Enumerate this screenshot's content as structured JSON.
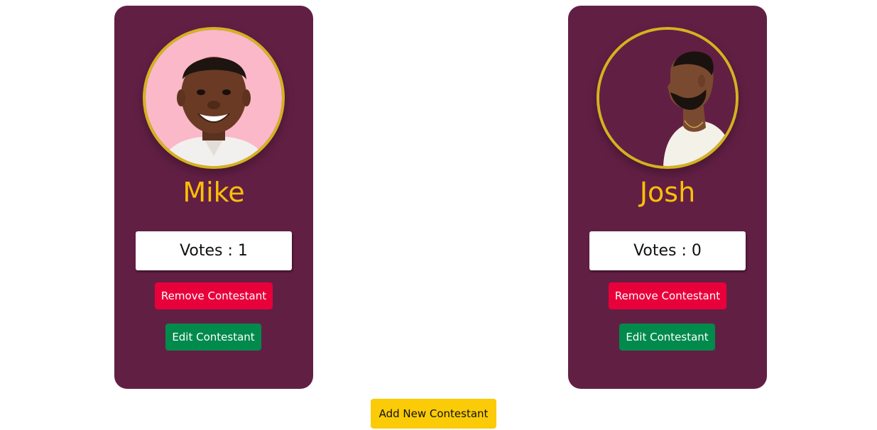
{
  "colors": {
    "card_background": "#621f44",
    "name_text": "#fbbf07",
    "avatar_ring": "#d4b21f",
    "remove_button": "#e8003a",
    "edit_button": "#008a4c",
    "add_button": "#fbcb07"
  },
  "contestants": [
    {
      "name": "Mike",
      "votes_label": "Votes : 1",
      "remove_label": "Remove Contestant",
      "edit_label": "Edit Contestant",
      "photo": "smiling-man-portrait"
    },
    {
      "name": "Josh",
      "votes_label": "Votes : 0",
      "remove_label": "Remove Contestant",
      "edit_label": "Edit Contestant",
      "photo": "bearded-man-profile-portrait"
    }
  ],
  "add_button_label": "Add New Contestant"
}
